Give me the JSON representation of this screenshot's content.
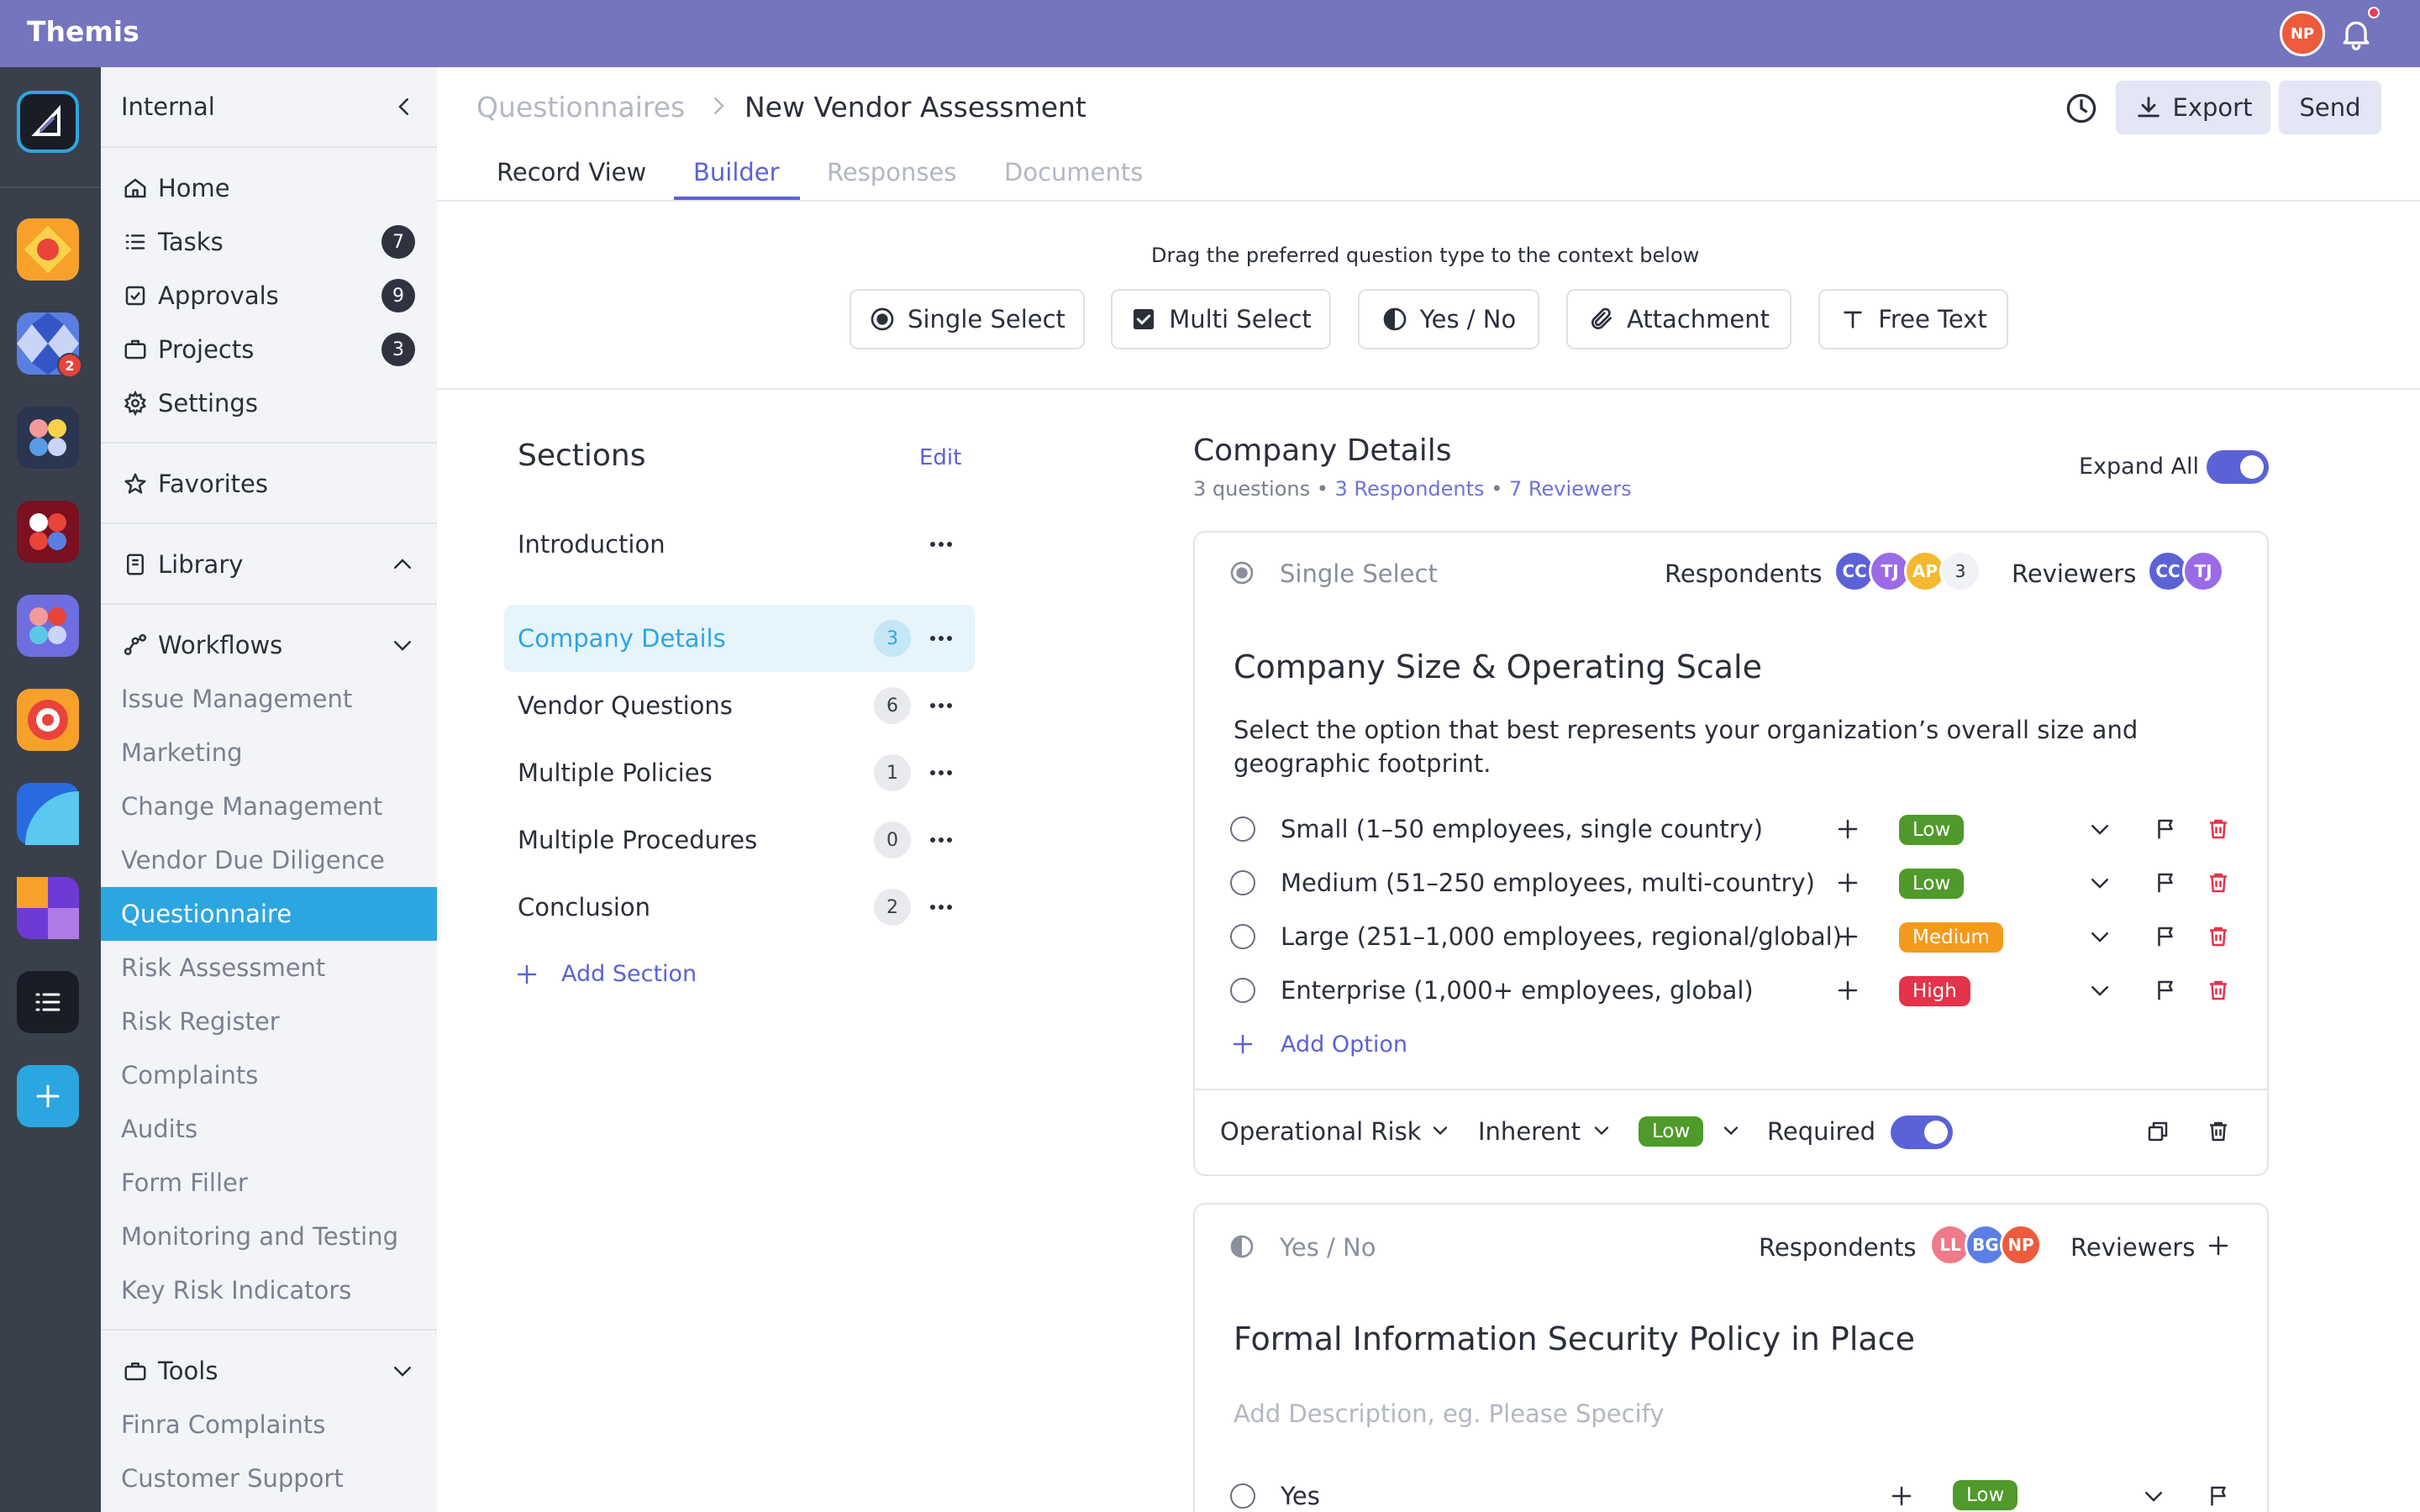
{
  "app": {
    "title": "Themis",
    "user_initials": "NP"
  },
  "rail": {
    "badge_count": "2"
  },
  "sidebar": {
    "workspace": "Internal",
    "items": [
      {
        "label": "Home",
        "icon": "home-icon"
      },
      {
        "label": "Tasks",
        "icon": "list-icon",
        "count": "7"
      },
      {
        "label": "Approvals",
        "icon": "check-square-icon",
        "count": "9"
      },
      {
        "label": "Projects",
        "icon": "briefcase-icon",
        "count": "3"
      },
      {
        "label": "Settings",
        "icon": "gear-icon"
      }
    ],
    "favorites": "Favorites",
    "library": "Library",
    "workflows": "Workflows",
    "workflow_items": [
      "Issue Management",
      "Marketing",
      "Change Management",
      "Vendor Due Diligence",
      "Questionnaire",
      "Risk Assessment",
      "Risk Register",
      "Complaints",
      "Audits",
      "Form Filler",
      "Monitoring and Testing",
      "Key Risk Indicators"
    ],
    "tools": "Tools",
    "tool_items": [
      "Finra Complaints",
      "Customer Support"
    ]
  },
  "header": {
    "breadcrumb_parent": "Questionnaires",
    "breadcrumb_current": "New Vendor Assessment",
    "export_label": "Export",
    "send_label": "Send"
  },
  "tabs": [
    "Record View",
    "Builder",
    "Responses",
    "Documents"
  ],
  "builder": {
    "drag_hint": "Drag the preferred question type to the context below",
    "question_types": [
      "Single Select",
      "Multi Select",
      "Yes / No",
      "Attachment",
      "Free Text"
    ]
  },
  "sections": {
    "title": "Sections",
    "edit_label": "Edit",
    "items": [
      {
        "label": "Introduction",
        "count": ""
      },
      {
        "label": "Company Details",
        "count": "3"
      },
      {
        "label": "Vendor Questions",
        "count": "6"
      },
      {
        "label": "Multiple Policies",
        "count": "1"
      },
      {
        "label": "Multiple Procedures",
        "count": "0"
      },
      {
        "label": "Conclusion",
        "count": "2"
      }
    ],
    "add_label": "Add Section"
  },
  "detail": {
    "title": "Company Details",
    "questions": "3 questions",
    "respondents": "3 Respondents",
    "reviewers": "7 Reviewers",
    "bullet": "•",
    "expand_all": "Expand All"
  },
  "labels": {
    "respondents": "Respondents",
    "reviewers": "Reviewers"
  },
  "q1": {
    "type": "Single Select",
    "respondent_avatars": [
      {
        "initials": "CC",
        "color": "#5b62d6"
      },
      {
        "initials": "TJ",
        "color": "#9b6ae6"
      },
      {
        "initials": "AP",
        "color": "#f5b82e"
      }
    ],
    "respondent_extra": "3",
    "reviewer_avatars": [
      {
        "initials": "CC",
        "color": "#5b62d6"
      },
      {
        "initials": "TJ",
        "color": "#9b6ae6"
      }
    ],
    "title": "Company Size & Operating Scale",
    "description_line1": "Select the option that best represents your organization’s overall size and",
    "description_line2": "geographic footprint.",
    "options": [
      {
        "label": "Small (1–50 employees, single country)",
        "risk": "Low"
      },
      {
        "label": "Medium (51–250 employees, multi-country)",
        "risk": "Low"
      },
      {
        "label": "Large (251–1,000 employees, regional/global)",
        "risk": "Medium"
      },
      {
        "label": "Enterprise (1,000+ employees, global)",
        "risk": "High"
      }
    ],
    "add_option": "Add Option",
    "footer": {
      "risk_type": "Operational Risk",
      "risk_kind": "Inherent",
      "risk_level": "Low",
      "required": "Required"
    }
  },
  "q2": {
    "type": "Yes / No",
    "respondent_avatars": [
      {
        "initials": "LL",
        "color": "#f07a8a"
      },
      {
        "initials": "BG",
        "color": "#5b7fe6"
      },
      {
        "initials": "NP",
        "color": "#ee5a3c"
      }
    ],
    "title": "Formal Information Security Policy in Place",
    "description_placeholder": "Add Description, eg. Please Specify",
    "options": [
      {
        "label": "Yes",
        "risk": "Low"
      }
    ]
  },
  "colors": {
    "accent": "#5b62d6",
    "active_nav": "#2ca6e0",
    "topbar": "#7474bf",
    "low": "#4f9a2a",
    "medium": "#f39a1c",
    "high": "#e4334a"
  }
}
